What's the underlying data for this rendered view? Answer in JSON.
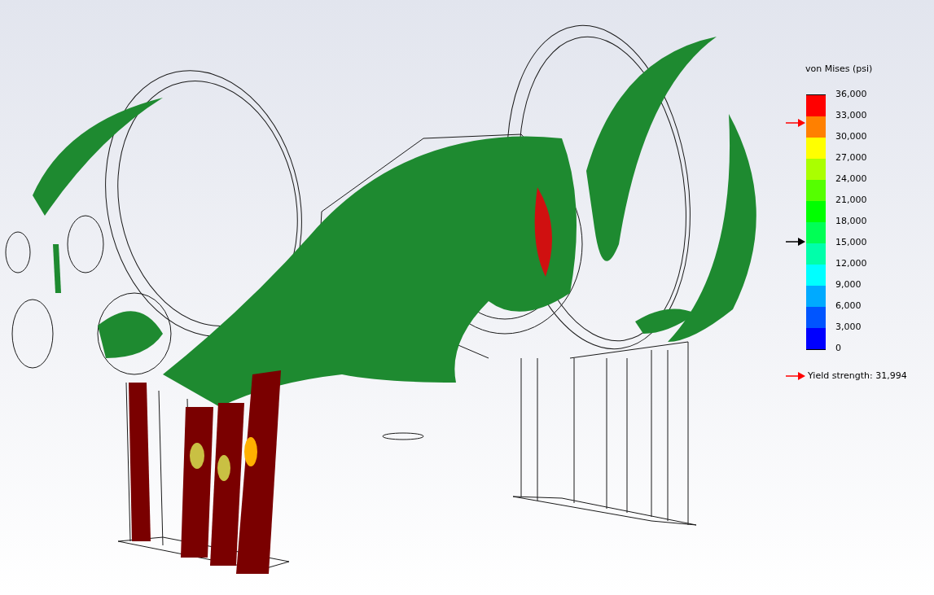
{
  "legend": {
    "title": "von Mises (psi)",
    "bands": [
      {
        "color": "#ff0000"
      },
      {
        "color": "#ff8000"
      },
      {
        "color": "#ffff00"
      },
      {
        "color": "#aaff00"
      },
      {
        "color": "#55ff00"
      },
      {
        "color": "#00ff00"
      },
      {
        "color": "#00ff55"
      },
      {
        "color": "#00ffaa"
      },
      {
        "color": "#00ffff"
      },
      {
        "color": "#00aaff"
      },
      {
        "color": "#0055ff"
      },
      {
        "color": "#0000ff"
      }
    ],
    "ticks": [
      "36,000",
      "33,000",
      "30,000",
      "27,000",
      "24,000",
      "21,000",
      "18,000",
      "15,000",
      "12,000",
      "9,000",
      "6,000",
      "3,000",
      "0"
    ],
    "markers": [
      {
        "color": "#ff0000",
        "level": 0.889
      },
      {
        "color": "#000000",
        "level": 0.42
      }
    ],
    "yield": {
      "label": "Yield strength: 31,994",
      "color": "#ff0000"
    }
  }
}
